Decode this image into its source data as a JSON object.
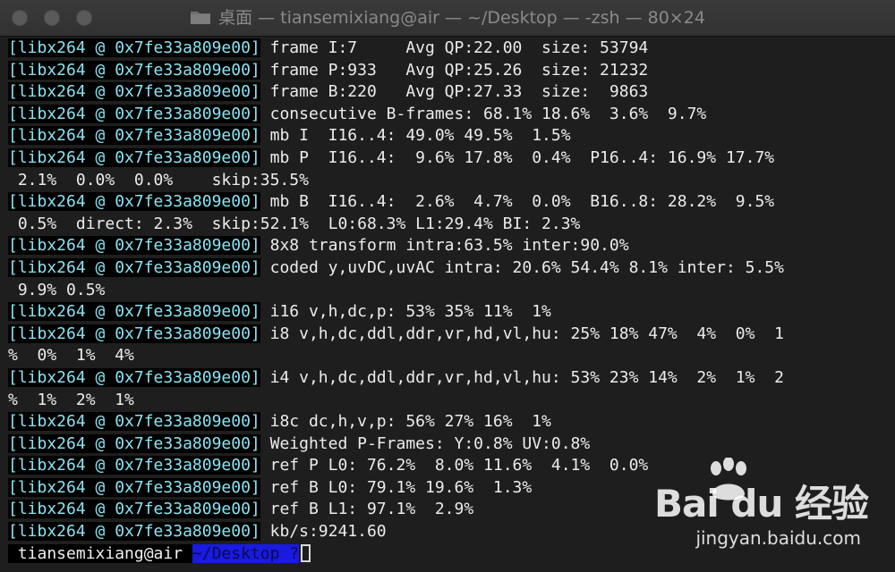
{
  "window": {
    "title": "桌面 — tiansemixiang@air — ~/Desktop — -zsh — 80×24"
  },
  "terminal": {
    "lines": [
      {
        "tag": "[libx264 @ 0x7fe33a809e00]",
        "text": " frame I:7     Avg QP:22.00  size: 53794"
      },
      {
        "tag": "[libx264 @ 0x7fe33a809e00]",
        "text": " frame P:933   Avg QP:25.26  size: 21232"
      },
      {
        "tag": "[libx264 @ 0x7fe33a809e00]",
        "text": " frame B:220   Avg QP:27.33  size:  9863"
      },
      {
        "tag": "[libx264 @ 0x7fe33a809e00]",
        "text": " consecutive B-frames: 68.1% 18.6%  3.6%  9.7%"
      },
      {
        "tag": "[libx264 @ 0x7fe33a809e00]",
        "text": " mb I  I16..4: 49.0% 49.5%  1.5%"
      },
      {
        "tag": "[libx264 @ 0x7fe33a809e00]",
        "text": " mb P  I16..4:  9.6% 17.8%  0.4%  P16..4: 16.9% 17.7%"
      },
      {
        "tag": "",
        "text": " 2.1%  0.0%  0.0%    skip:35.5%"
      },
      {
        "tag": "[libx264 @ 0x7fe33a809e00]",
        "text": " mb B  I16..4:  2.6%  4.7%  0.0%  B16..8: 28.2%  9.5%"
      },
      {
        "tag": "",
        "text": " 0.5%  direct: 2.3%  skip:52.1%  L0:68.3% L1:29.4% BI: 2.3%"
      },
      {
        "tag": "[libx264 @ 0x7fe33a809e00]",
        "text": " 8x8 transform intra:63.5% inter:90.0%"
      },
      {
        "tag": "[libx264 @ 0x7fe33a809e00]",
        "text": " coded y,uvDC,uvAC intra: 20.6% 54.4% 8.1% inter: 5.5%"
      },
      {
        "tag": "",
        "text": " 9.9% 0.5%"
      },
      {
        "tag": "[libx264 @ 0x7fe33a809e00]",
        "text": " i16 v,h,dc,p: 53% 35% 11%  1%"
      },
      {
        "tag": "[libx264 @ 0x7fe33a809e00]",
        "text": " i8 v,h,dc,ddl,ddr,vr,hd,vl,hu: 25% 18% 47%  4%  0%  1"
      },
      {
        "tag": "",
        "text": "%  0%  1%  4%"
      },
      {
        "tag": "[libx264 @ 0x7fe33a809e00]",
        "text": " i4 v,h,dc,ddl,ddr,vr,hd,vl,hu: 53% 23% 14%  2%  1%  2"
      },
      {
        "tag": "",
        "text": "%  1%  2%  1%"
      },
      {
        "tag": "[libx264 @ 0x7fe33a809e00]",
        "text": " i8c dc,h,v,p: 56% 27% 16%  1%"
      },
      {
        "tag": "[libx264 @ 0x7fe33a809e00]",
        "text": " Weighted P-Frames: Y:0.8% UV:0.8%"
      },
      {
        "tag": "[libx264 @ 0x7fe33a809e00]",
        "text": " ref P L0: 76.2%  8.0% 11.6%  4.1%  0.0%"
      },
      {
        "tag": "[libx264 @ 0x7fe33a809e00]",
        "text": " ref B L0: 79.1% 19.6%  1.3%"
      },
      {
        "tag": "[libx264 @ 0x7fe33a809e00]",
        "text": " ref B L1: 97.1%  2.9%"
      },
      {
        "tag": "[libx264 @ 0x7fe33a809e00]",
        "text": " kb/s:9241.60"
      }
    ],
    "prompt": {
      "user": " tiansemixiang@air ",
      "path": "~/Desktop ",
      "glyph": "?"
    }
  },
  "watermark": {
    "brand": "Bai du 经验",
    "url": "jingyan.baidu.com"
  }
}
